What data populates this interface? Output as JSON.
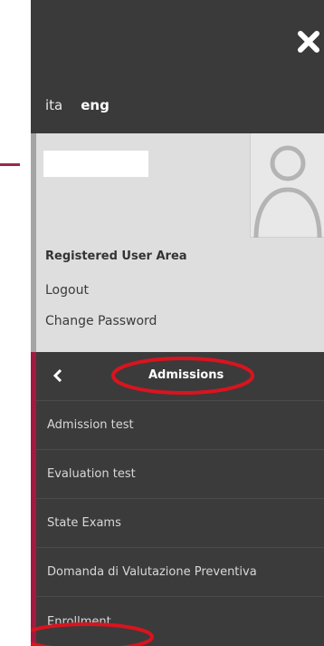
{
  "header": {
    "close_icon": "close-icon"
  },
  "languages": [
    {
      "label": "ita",
      "active": false
    },
    {
      "label": "eng",
      "active": true
    }
  ],
  "user_area": {
    "title": "Registered User Area",
    "logout": "Logout",
    "change_password": "Change Password",
    "avatar_icon": "avatar-placeholder-icon"
  },
  "menu": {
    "back_icon": "chevron-left-icon",
    "title": "Admissions",
    "items": [
      {
        "label": "Admission test"
      },
      {
        "label": "Evaluation test"
      },
      {
        "label": "State Exams"
      },
      {
        "label": "Domanda di Valutazione Preventiva"
      },
      {
        "label": "Enrollment"
      }
    ]
  },
  "colors": {
    "drawer_bg": "#3a3a3a",
    "user_panel_bg": "#dedede",
    "accent": "#a3193f",
    "highlight": "#d9141f"
  }
}
